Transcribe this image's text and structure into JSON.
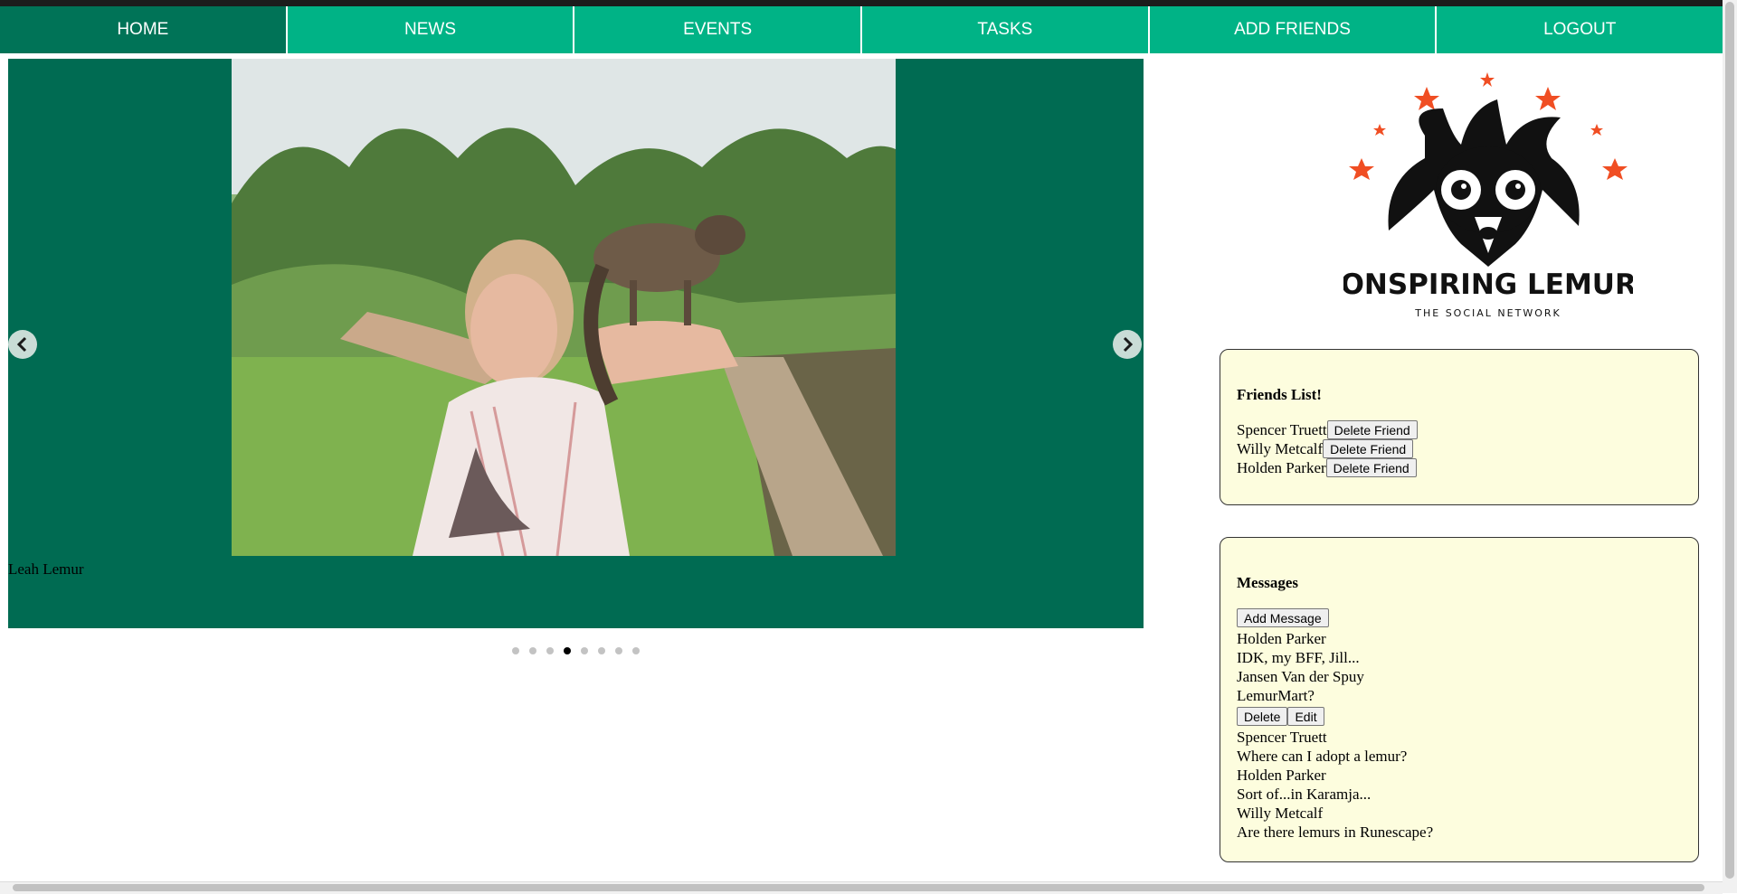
{
  "nav": {
    "items": [
      {
        "label": "HOME"
      },
      {
        "label": "NEWS"
      },
      {
        "label": "EVENTS"
      },
      {
        "label": "TASKS"
      },
      {
        "label": "ADD FRIENDS"
      },
      {
        "label": "LOGOUT"
      }
    ],
    "active_index": 0
  },
  "carousel": {
    "caption": "Leah Lemur",
    "slide_count": 8,
    "active_slide": 4,
    "image": "woman-with-lemur-photo",
    "prev_icon": "chevron-left-icon",
    "next_icon": "chevron-right-icon"
  },
  "logo": {
    "title": "CONSPIRING LEMURS",
    "subtitle": "THE SOCIAL NETWORK"
  },
  "friends": {
    "title": "Friends List!",
    "delete_label": "Delete Friend",
    "names": [
      "Spencer Truett",
      "Willy Metcalf",
      "Holden Parker"
    ]
  },
  "messages": {
    "title": "Messages",
    "add_label": "Add Message",
    "delete_label": "Delete",
    "edit_label": "Edit",
    "items": [
      {
        "author": "Holden Parker",
        "text": "IDK, my BFF, Jill..."
      },
      {
        "author": "Jansen Van der Spuy",
        "text": "LemurMart?"
      },
      {
        "author": "Spencer Truett",
        "text": "Where can I adopt a lemur?"
      },
      {
        "author": "Holden Parker",
        "text": "Sort of...in Karamja..."
      },
      {
        "author": "Willy Metcalf",
        "text": "Are there lemurs in Runescape?"
      }
    ]
  },
  "colors": {
    "nav": "#00b386",
    "nav_active": "#007357",
    "carousel_bg": "#006b52",
    "panel_bg": "#fdfdde",
    "logo_star": "#f04e23"
  }
}
